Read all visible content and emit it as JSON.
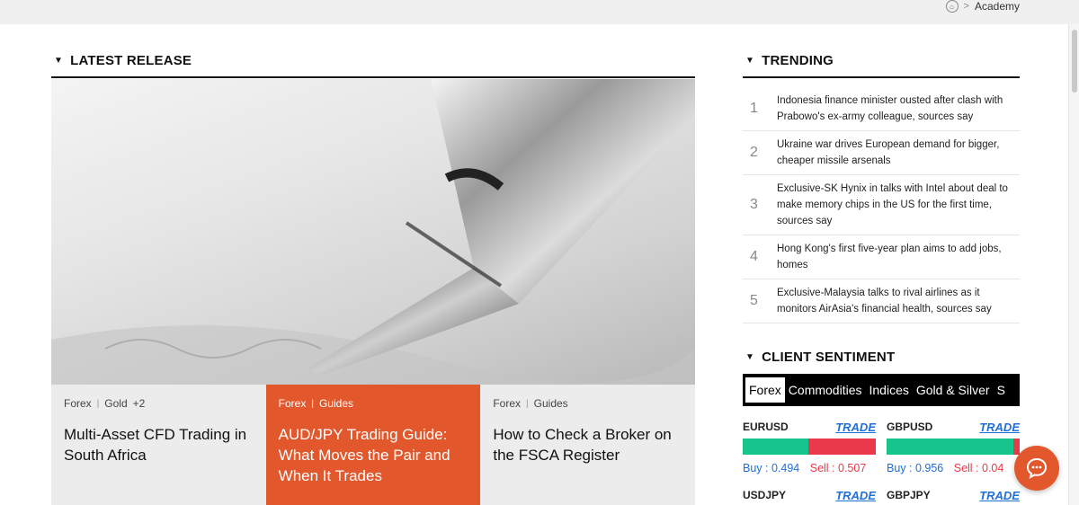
{
  "breadcrumb": {
    "home_icon": "home-icon",
    "separator": ">",
    "current": "Academy"
  },
  "latest": {
    "title": "LATEST RELEASE",
    "cards": [
      {
        "tag1": "Forex",
        "tag2": "Gold",
        "tag_more": "+2",
        "title": "Multi-Asset CFD Trading in South Africa"
      },
      {
        "tag1": "Forex",
        "tag2": "Guides",
        "title": "AUD/JPY Trading Guide: What Moves the Pair and When It Trades"
      },
      {
        "tag1": "Forex",
        "tag2": "Guides",
        "title": "How to Check a Broker on the FSCA Register"
      }
    ]
  },
  "trending": {
    "title": "TRENDING",
    "items": [
      {
        "num": "1",
        "text": "Indonesia finance minister ousted after clash with Prabowo's ex-army colleague, sources say"
      },
      {
        "num": "2",
        "text": "Ukraine war drives European demand for bigger, cheaper missile arsenals"
      },
      {
        "num": "3",
        "text": "Exclusive-SK Hynix in talks with Intel about deal to make memory chips in the US for the first time, sources say"
      },
      {
        "num": "4",
        "text": "Hong Kong's first five-year plan aims to add jobs, homes"
      },
      {
        "num": "5",
        "text": "Exclusive-Malaysia talks to rival airlines as it monitors AirAsia's financial health, sources say"
      }
    ]
  },
  "sentiment": {
    "title": "CLIENT SENTIMENT",
    "tabs": [
      "Forex",
      "Commodities",
      "Indices",
      "Gold & Silver",
      "S"
    ],
    "active_tab": "Forex",
    "pairs": [
      {
        "name": "EURUSD",
        "trade": "TRADE",
        "buy": "Buy : 0.494",
        "sell": "Sell : 0.507",
        "buy_ratio": 0.494
      },
      {
        "name": "GBPUSD",
        "trade": "TRADE",
        "buy": "Buy : 0.956",
        "sell": "Sell : 0.04",
        "buy_ratio": 0.956
      },
      {
        "name": "USDJPY",
        "trade": "TRADE"
      },
      {
        "name": "GBPJPY",
        "trade": "TRADE"
      }
    ]
  },
  "colors": {
    "accent": "#e2582c",
    "buy": "#16c58b",
    "sell": "#e9394a",
    "link": "#1e6fd9"
  },
  "chat": {
    "icon": "chat-bubble-icon"
  }
}
